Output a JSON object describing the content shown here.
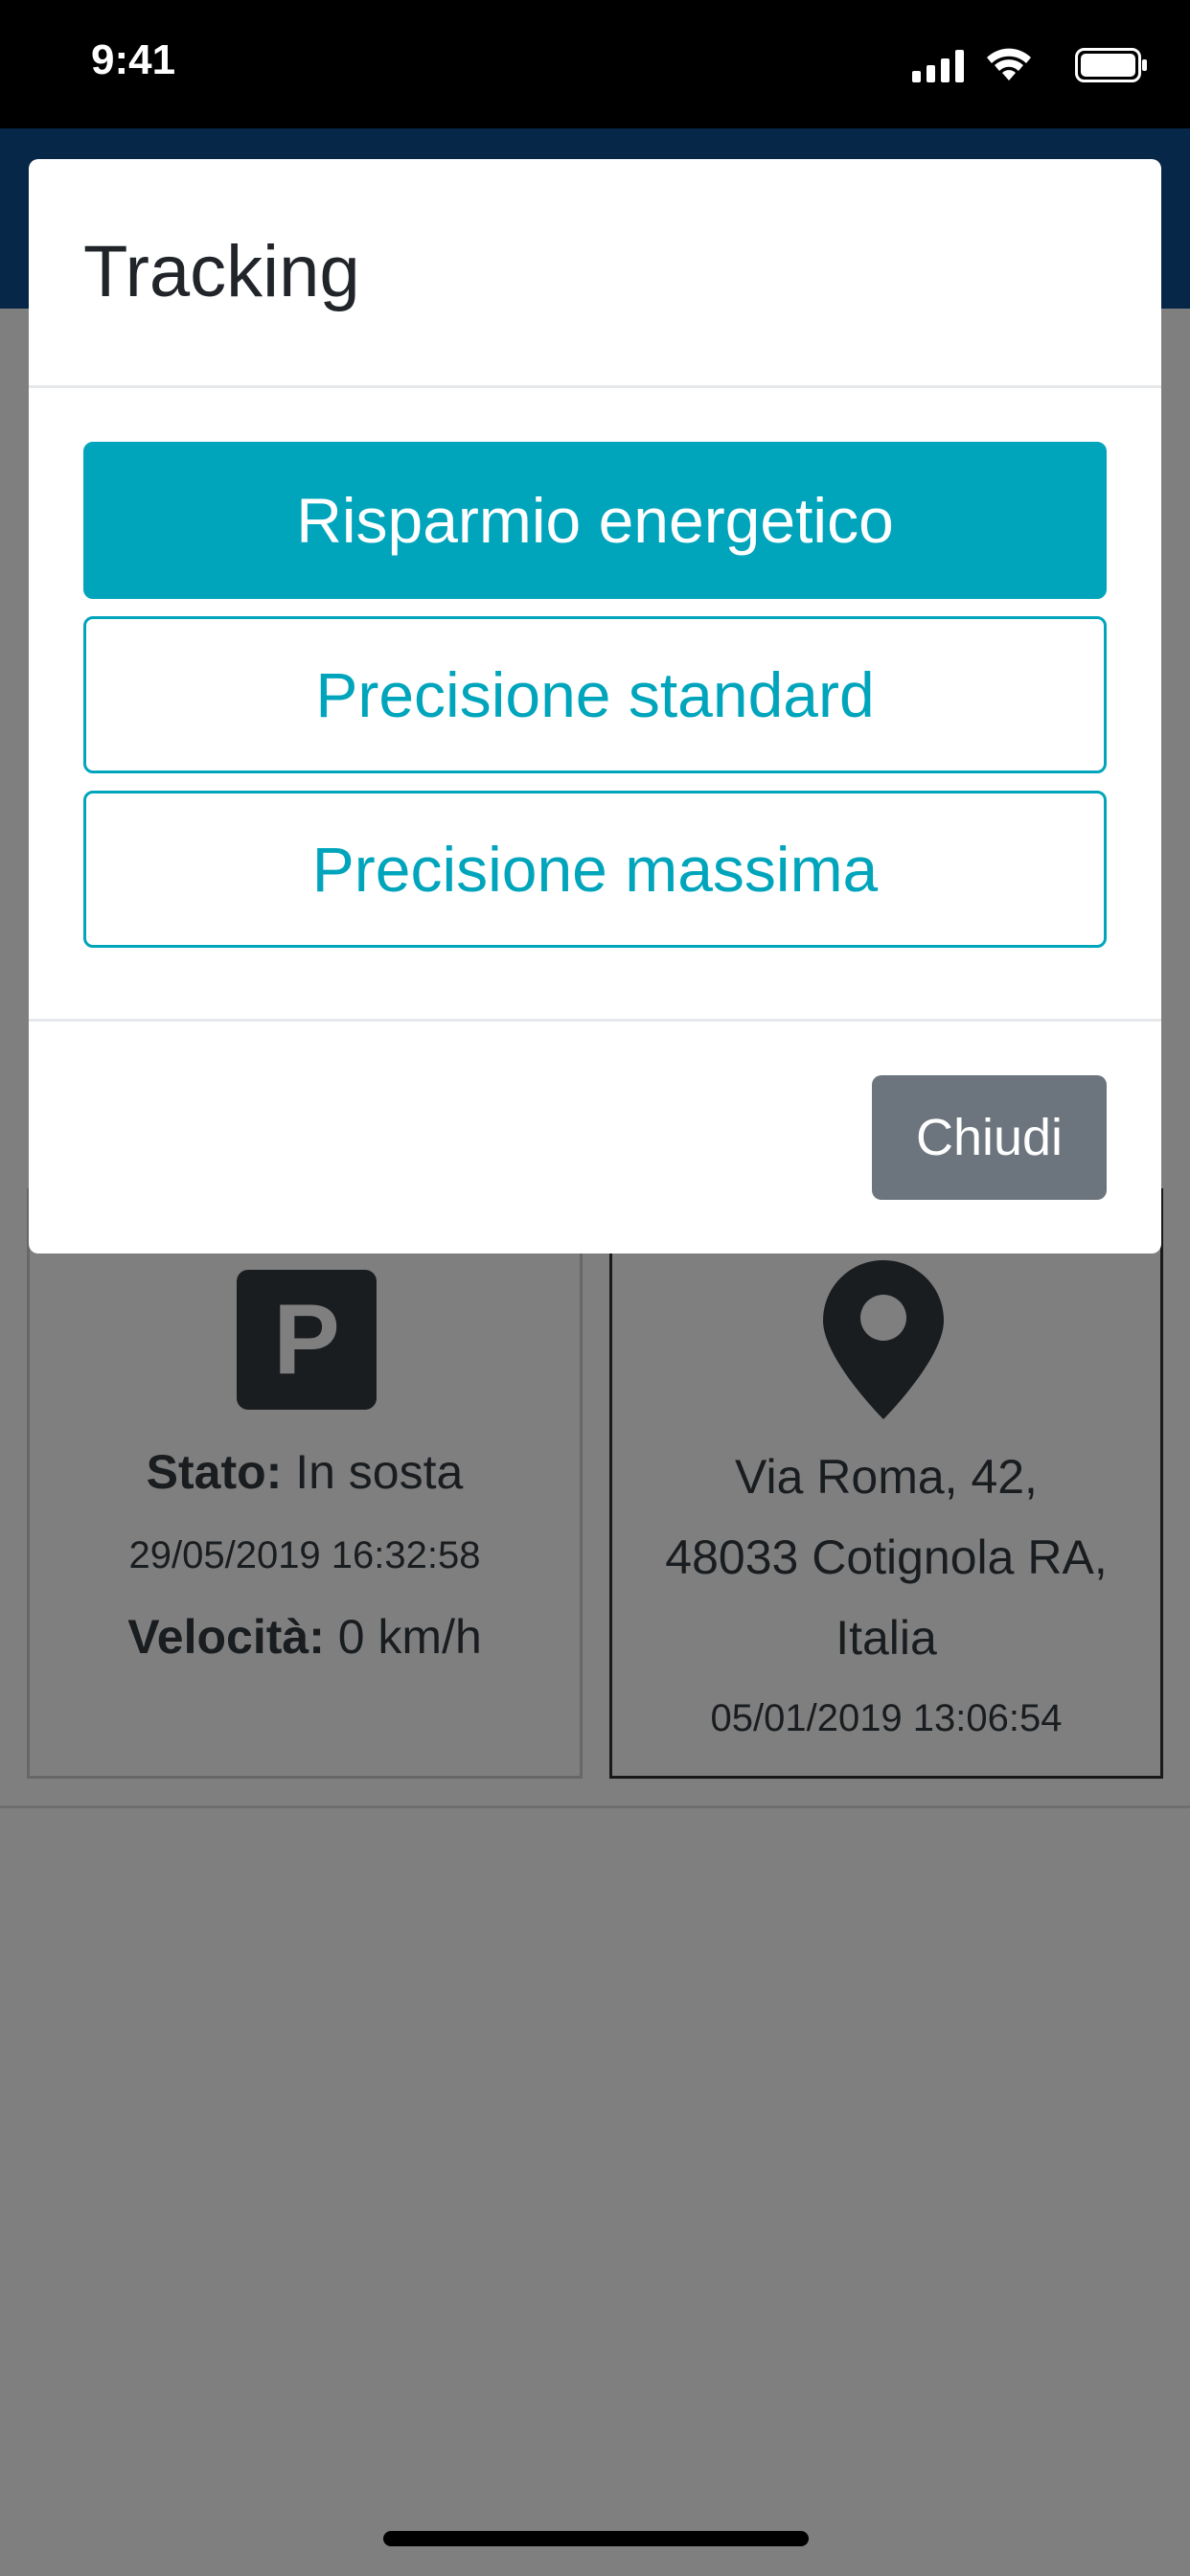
{
  "status_bar": {
    "time": "9:41"
  },
  "cards": {
    "left": {
      "icon": "parking-icon",
      "icon_letter": "P",
      "status_label": "Stato:",
      "status_value": " In sosta",
      "timestamp": "29/05/2019 16:32:58",
      "speed_label": "Velocità:",
      "speed_value": " 0 km/h"
    },
    "right": {
      "icon": "map-pin-icon",
      "address_line1": "Via Roma, 42,",
      "address_line2": "48033 Cotignola RA,",
      "address_line3": "Italia",
      "timestamp": "05/01/2019 13:06:54"
    }
  },
  "modal": {
    "title": "Tracking",
    "options": [
      {
        "label": "Risparmio energetico",
        "selected": true
      },
      {
        "label": "Precisione standard",
        "selected": false
      },
      {
        "label": "Precisione massima",
        "selected": false
      }
    ],
    "close_label": "Chiudi"
  },
  "colors": {
    "accent": "#00a5bc",
    "secondary_button": "#6c757d",
    "header": "#0d4f8f"
  }
}
